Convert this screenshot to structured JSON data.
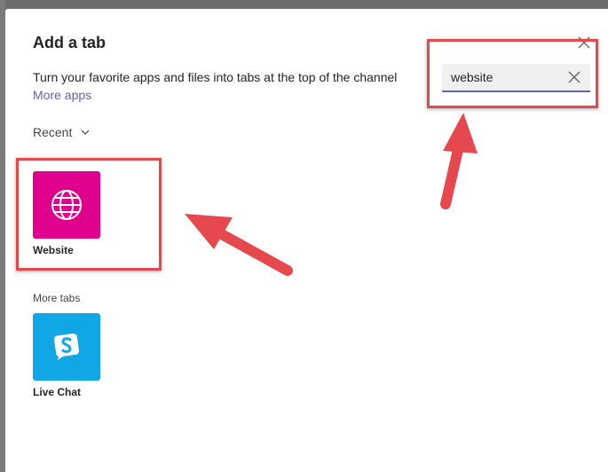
{
  "dialog": {
    "title": "Add a tab",
    "subtitle": "Turn your favorite apps and files into tabs at the top of the channel",
    "more_apps_label": "More apps",
    "close_icon": "close-icon"
  },
  "search": {
    "value": "website",
    "clear_icon": "close-icon"
  },
  "filter": {
    "label": "Recent",
    "icon": "chevron-down-icon"
  },
  "recent_apps": [
    {
      "label": "Website",
      "icon": "globe-icon",
      "color": "#e0008e"
    }
  ],
  "more_tabs": {
    "heading": "More tabs",
    "apps": [
      {
        "label": "Live Chat",
        "icon": "live-chat-icon",
        "color": "#11a7e6"
      }
    ]
  },
  "annotation_color": "#e5484d"
}
